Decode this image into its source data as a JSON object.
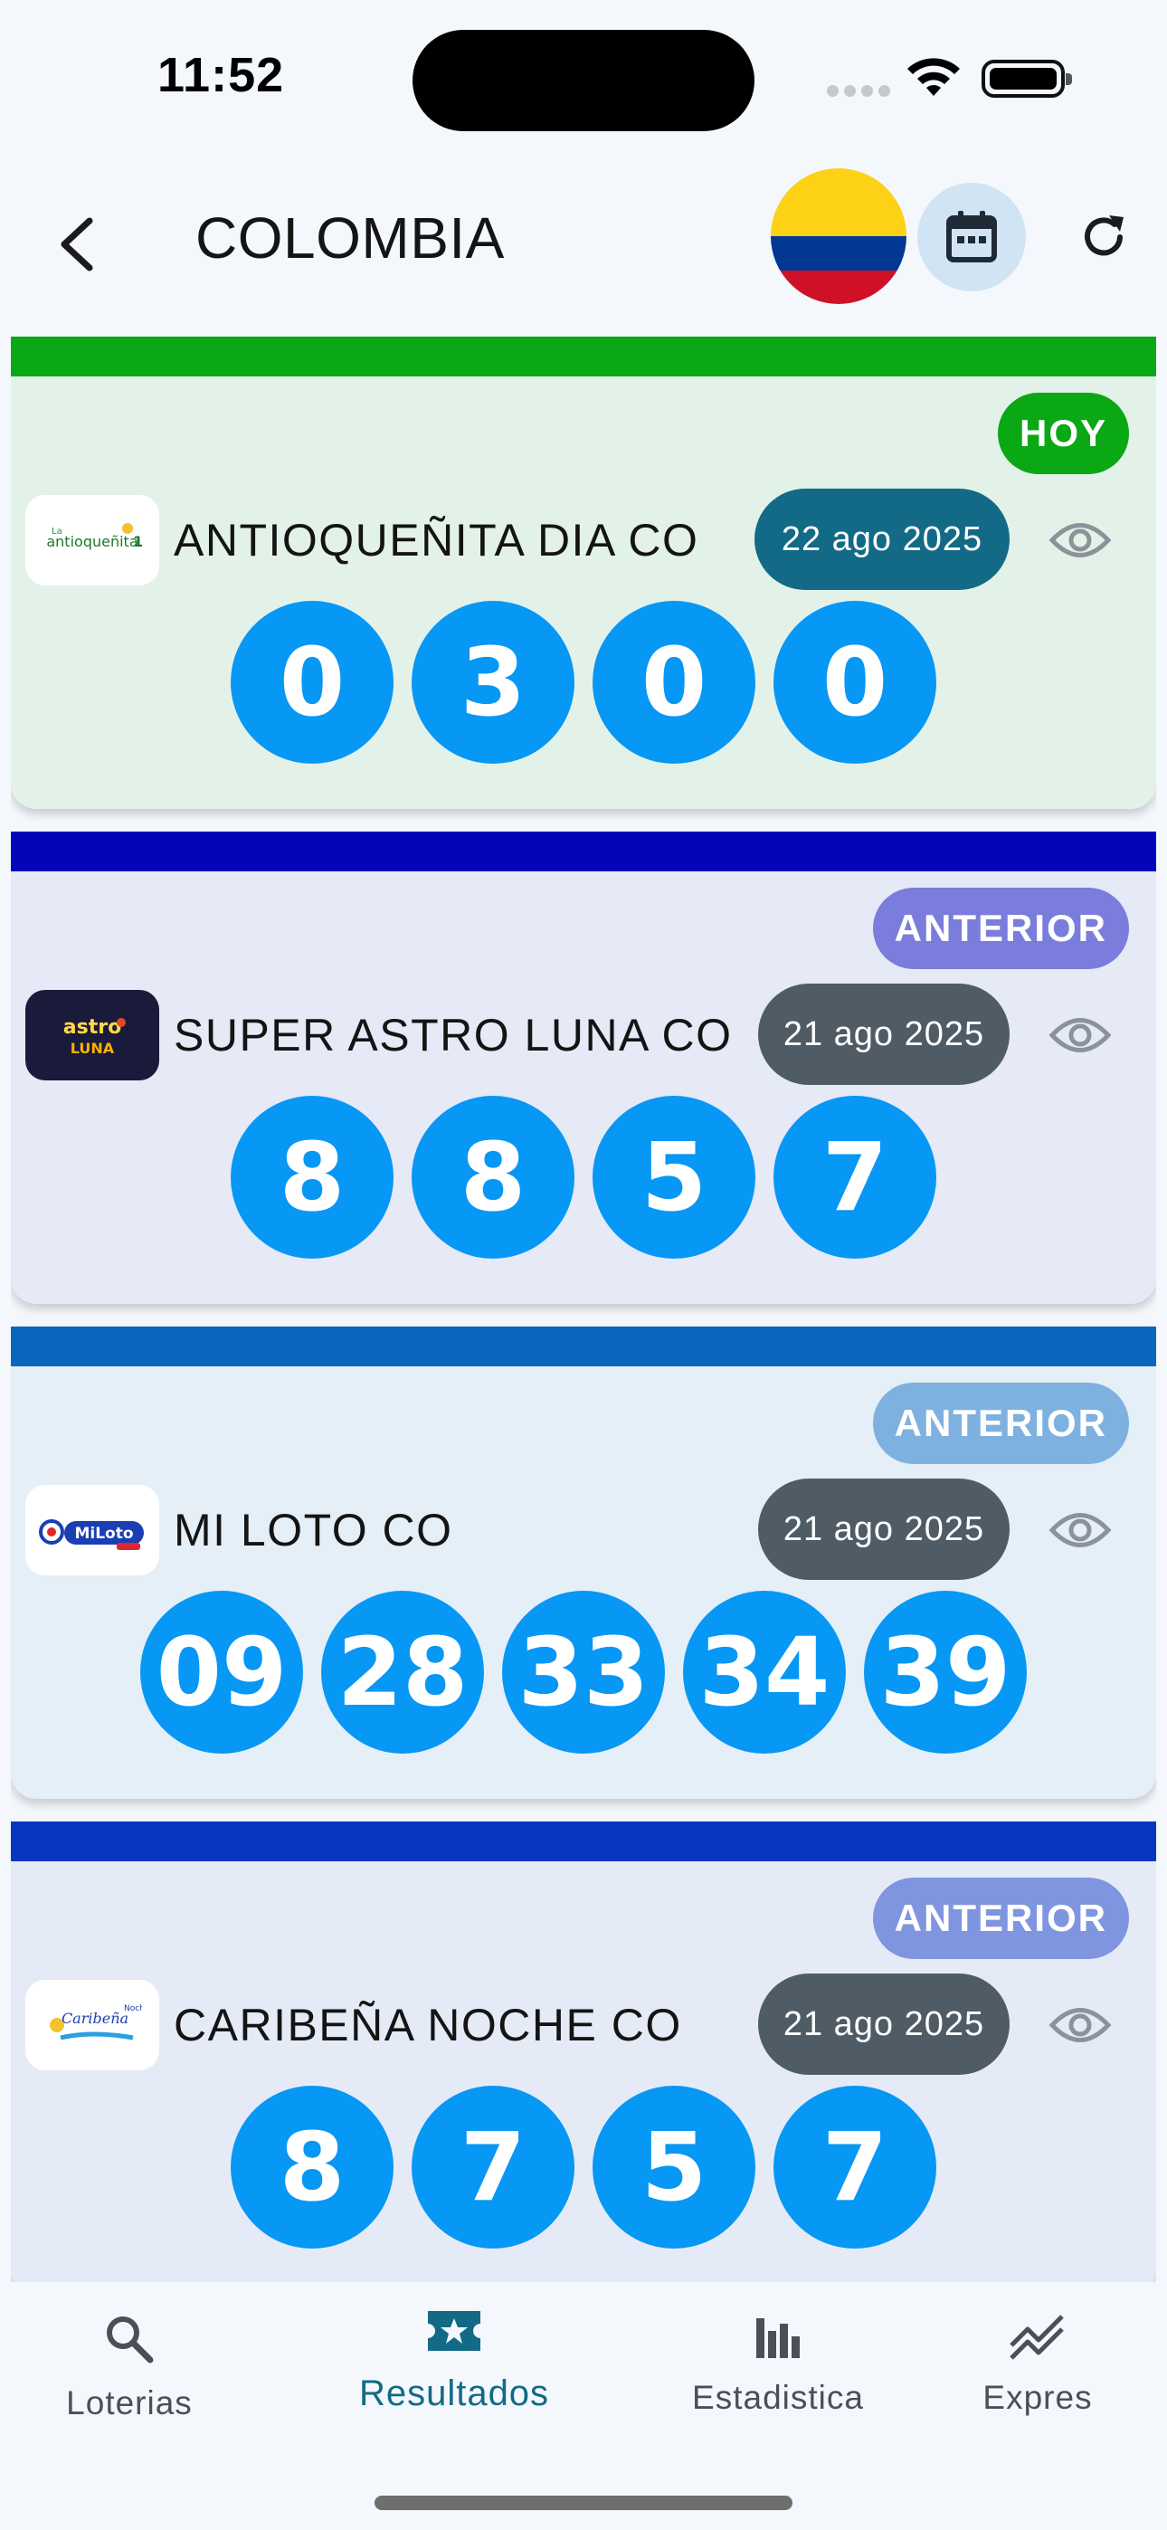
{
  "status_bar": {
    "time": "11:52"
  },
  "app_bar": {
    "title": "COLOMBIA",
    "flag": "colombia-flag",
    "icons": [
      "back-arrow-icon",
      "calendar-icon",
      "refresh-icon"
    ]
  },
  "colors": {
    "ball": "#0797f5",
    "hoy_badge": "#0aa814",
    "accent": "#136a86"
  },
  "cards": [
    {
      "stripe_color": "#0aa814",
      "bg_color": "#e3f2e9",
      "badge": "HOY",
      "badge_color": "#0aa814",
      "logo_text": "antioqueñita 1",
      "logo_style": "light",
      "name": "ANTIOQUEÑITA DIA CO",
      "date": "22 ago 2025",
      "date_color": "#136a86",
      "numbers": [
        "0",
        "3",
        "0",
        "0"
      ]
    },
    {
      "stripe_color": "#0505b8",
      "bg_color": "#e6e9f6",
      "badge": "ANTERIOR",
      "badge_color": "#7a7ddb",
      "logo_text": "astro LUNA",
      "logo_style": "dark",
      "name": "SUPER ASTRO LUNA CO",
      "date": "21 ago 2025",
      "date_color": "#4f5c66",
      "numbers": [
        "8",
        "8",
        "5",
        "7"
      ]
    },
    {
      "stripe_color": "#0866be",
      "bg_color": "#e4eff8",
      "badge": "ANTERIOR",
      "badge_color": "#7eb1df",
      "logo_text": "MiLoto",
      "logo_style": "miloto",
      "name": "MI LOTO CO",
      "date": "21 ago 2025",
      "date_color": "#4f5c66",
      "numbers": [
        "09",
        "28",
        "33",
        "34",
        "39"
      ]
    },
    {
      "stripe_color": "#0836be",
      "bg_color": "#e5ebf6",
      "badge": "ANTERIOR",
      "badge_color": "#7f95e0",
      "logo_text": "La Caribeña Noche",
      "logo_style": "light",
      "name": "CARIBEÑA NOCHE CO",
      "date": "21 ago 2025",
      "date_color": "#4f5c66",
      "numbers": [
        "8",
        "7",
        "5",
        "7"
      ]
    }
  ],
  "bottom_nav": {
    "items": [
      {
        "label": "Loterias",
        "icon": "search-icon",
        "active": false
      },
      {
        "label": "Resultados",
        "icon": "ticket-star-icon",
        "active": true
      },
      {
        "label": "Estadistica",
        "icon": "bar-chart-icon",
        "active": false
      },
      {
        "label": "Expres",
        "icon": "trending-icon",
        "active": false
      }
    ]
  }
}
